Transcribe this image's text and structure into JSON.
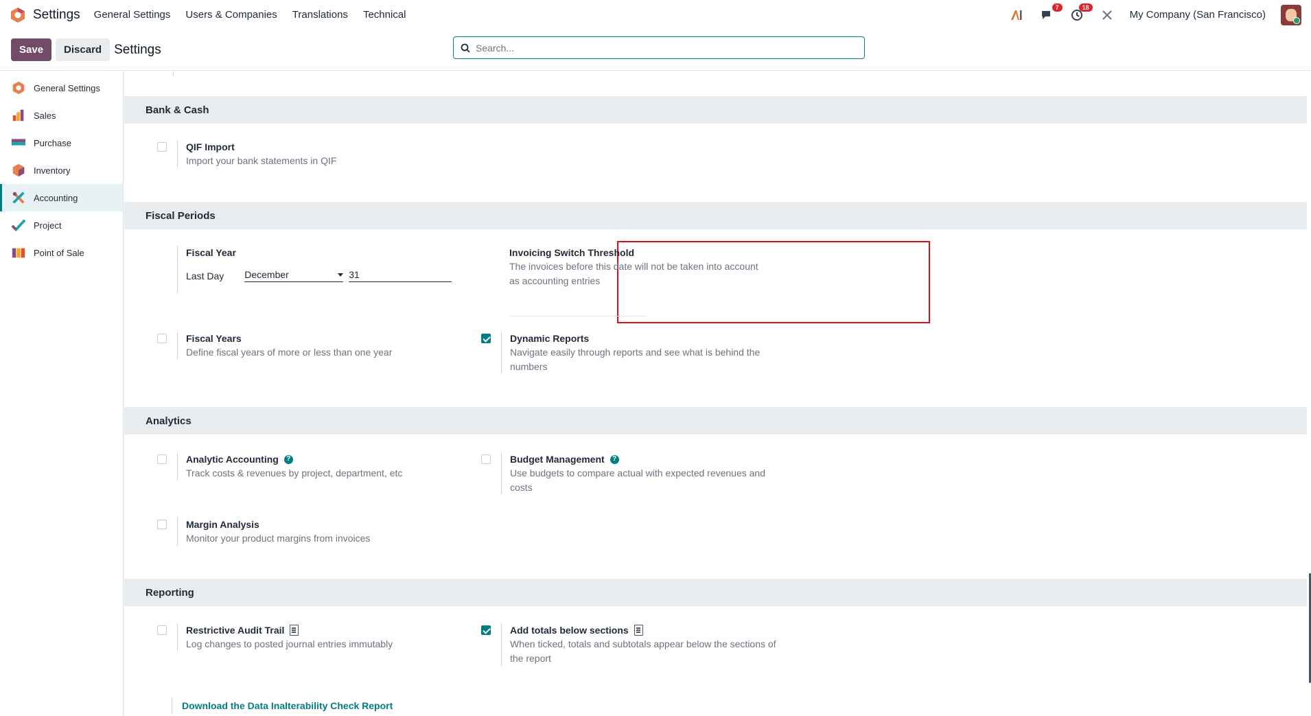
{
  "topnav": {
    "app_name": "Settings",
    "menu": [
      "General Settings",
      "Users & Companies",
      "Translations",
      "Technical"
    ],
    "messages_count": "7",
    "activities_count": "18",
    "company": "My Company (San Francisco)"
  },
  "control": {
    "save_label": "Save",
    "discard_label": "Discard",
    "title": "Settings",
    "search_placeholder": "Search..."
  },
  "sidebar": {
    "items": [
      {
        "label": "General Settings",
        "icon": "settings-logo-icon"
      },
      {
        "label": "Sales",
        "icon": "sales-icon"
      },
      {
        "label": "Purchase",
        "icon": "purchase-icon"
      },
      {
        "label": "Inventory",
        "icon": "inventory-icon"
      },
      {
        "label": "Accounting",
        "icon": "accounting-icon",
        "active": true
      },
      {
        "label": "Project",
        "icon": "project-icon"
      },
      {
        "label": "Point of Sale",
        "icon": "point-of-sale-icon"
      }
    ]
  },
  "sections": {
    "bank": {
      "title": "Bank & Cash",
      "qif_title": "QIF Import",
      "qif_desc": "Import your bank statements in QIF",
      "qif_checked": false
    },
    "fiscal": {
      "title": "Fiscal Periods",
      "fiscal_year_title": "Fiscal Year",
      "last_day_label": "Last Day",
      "last_day_month": "December",
      "last_day_day": "31",
      "threshold_title": "Invoicing Switch Threshold",
      "threshold_desc": "The invoices before this date will not be taken into account as accounting entries",
      "fiscal_years_title": "Fiscal Years",
      "fiscal_years_desc": "Define fiscal years of more or less than one year",
      "fiscal_years_checked": false,
      "dynamic_title": "Dynamic Reports",
      "dynamic_desc": "Navigate easily through reports and see what is behind the numbers",
      "dynamic_checked": true
    },
    "analytics": {
      "title": "Analytics",
      "analytic_title": "Analytic Accounting",
      "analytic_desc": "Track costs & revenues by project, department, etc",
      "budget_title": "Budget Management",
      "budget_desc": "Use budgets to compare actual with expected revenues and costs",
      "margin_title": "Margin Analysis",
      "margin_desc": "Monitor your product margins from invoices"
    },
    "reporting": {
      "title": "Reporting",
      "audit_title": "Restrictive Audit Trail",
      "audit_desc": "Log changes to posted journal entries immutably",
      "audit_checked": false,
      "totals_title": "Add totals below sections",
      "totals_desc": "When ticked, totals and subtotals appear below the sections of the report",
      "totals_checked": true,
      "download_link": "Download the Data Inalterability Check Report"
    }
  },
  "colors": {
    "brand": "#714b67",
    "accent": "#017e84",
    "highlight": "#e0101b"
  }
}
